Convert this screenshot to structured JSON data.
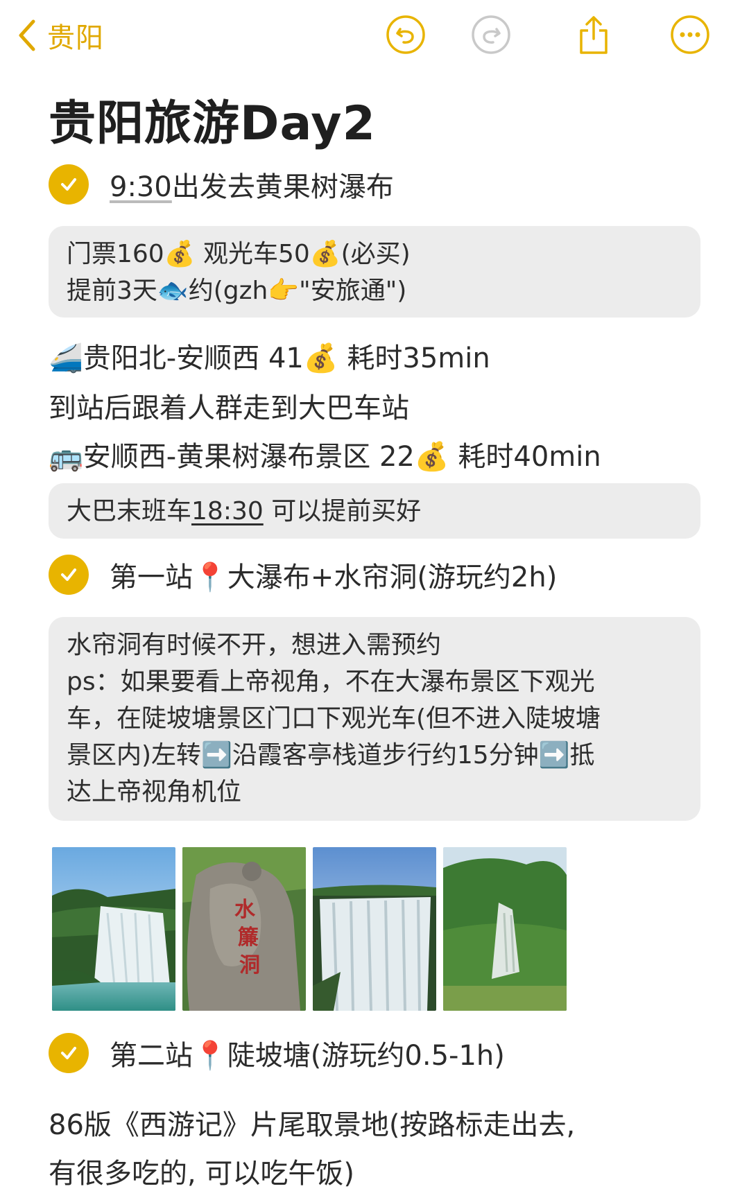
{
  "nav": {
    "back_label": "贵阳",
    "buttons": [
      "undo-icon",
      "redo-icon",
      "share-icon",
      "more-icon"
    ],
    "accent_color": "#e8b400"
  },
  "title": "贵阳旅游Day2",
  "item1": {
    "time": "9:30",
    "text": "出发去黄果树瀑布"
  },
  "block1": {
    "line1": "门票160💰  观光车50💰(必买)",
    "line2": "提前3天🐟约(gzh👉\"安旅通\")"
  },
  "train_line": "🚄贵阳北-安顺西 41💰 耗时35min",
  "walk_line": "到站后跟着人群走到大巴车站",
  "bus_line": "🚌安顺西-黄果树瀑布景区 22💰 耗时40min",
  "block2": {
    "prefix": "大巴末班车",
    "time": "18:30",
    "suffix": " 可以提前买好"
  },
  "item2": {
    "text": "第一站📍大瀑布+水帘洞(游玩约2h)"
  },
  "block3": {
    "lines": [
      "水帘洞有时候不开，想进入需预约",
      "ps：如果要看上帝视角，不在大瀑布景区下观光",
      "车，在陡坡塘景区门口下观光车(但不进入陡坡塘",
      "景区内)左转➡️沿霞客亭栈道步行约15分钟➡️抵",
      "达上帝视角机位"
    ]
  },
  "photos": [
    {
      "label": "waterfall-photo-1"
    },
    {
      "label": "water-curtain-cave-rock-photo"
    },
    {
      "label": "waterfall-photo-2"
    },
    {
      "label": "doupotang-photo"
    }
  ],
  "item3": {
    "text": "第二站📍陡坡塘(游玩约0.5-1h)"
  },
  "tail_line1": "86版《西游记》片尾取景地(按路标走出去,",
  "tail_line2": "有很多吃的, 可以吃午饭)"
}
